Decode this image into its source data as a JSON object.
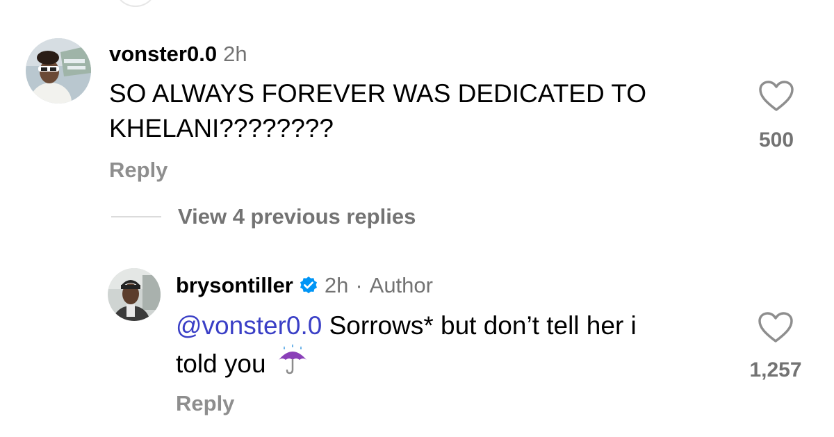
{
  "comments": [
    {
      "username": "vonster0.0",
      "time": "2h",
      "text_lines": [
        "SO ALWAYS FOREVER WAS DEDICATED TO",
        "KHELANI????????"
      ],
      "likes": "500",
      "reply_label": "Reply"
    }
  ],
  "view_previous": "View 4 previous replies",
  "reply": {
    "username": "brysontiller",
    "verified": true,
    "time": "2h",
    "separator": "·",
    "author_tag": "Author",
    "mention": "@vonster0.0",
    "text_line1": "Sorrows* but don’t tell her i",
    "text_line2": "told you",
    "emoji": "umbrella-with-rain-drops",
    "likes": "1,257",
    "reply_label": "Reply"
  },
  "colors": {
    "mention": "#3a3fc6",
    "meta": "#737373",
    "verified": "#0095f6"
  }
}
